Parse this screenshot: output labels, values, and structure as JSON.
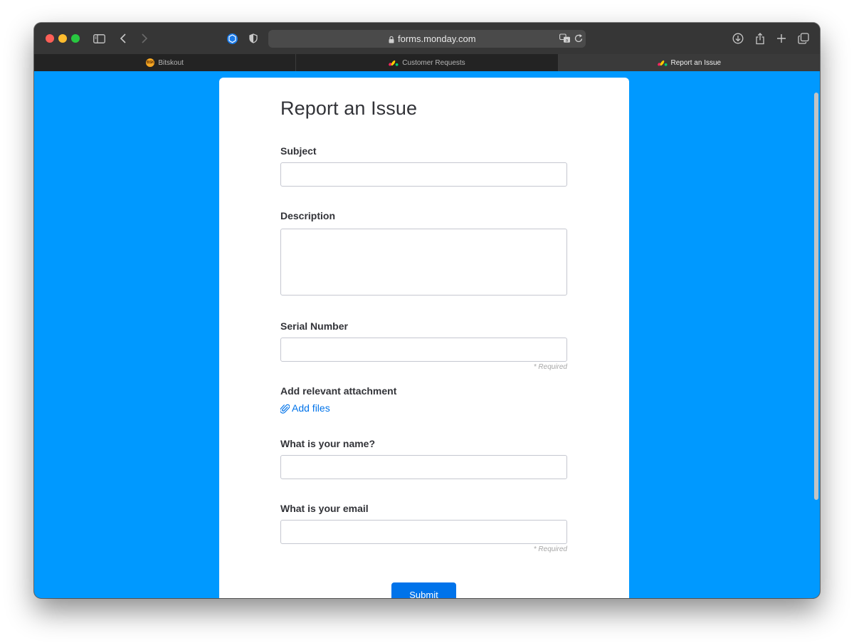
{
  "browser": {
    "url": "forms.monday.com",
    "tabs": [
      {
        "label": "Bitskout",
        "favicon": "bitskout-logo-icon",
        "active": false
      },
      {
        "label": "Customer Requests",
        "favicon": "monday-logo-icon",
        "active": false
      },
      {
        "label": "Report an Issue",
        "favicon": "monday-logo-icon",
        "active": true
      }
    ]
  },
  "form": {
    "title": "Report an Issue",
    "fields": {
      "subject": {
        "label": "Subject",
        "value": ""
      },
      "description": {
        "label": "Description",
        "value": ""
      },
      "serial_number": {
        "label": "Serial Number",
        "value": "",
        "required_note": "* Required"
      },
      "attachment": {
        "label": "Add relevant attachment",
        "action": "Add files"
      },
      "name": {
        "label": "What is your name?",
        "value": ""
      },
      "email": {
        "label": "What is your email",
        "value": "",
        "required_note": "* Required"
      }
    },
    "submit_label": "Submit"
  },
  "colors": {
    "page_background": "#0099ff",
    "primary": "#0073ea",
    "text": "#323338"
  }
}
